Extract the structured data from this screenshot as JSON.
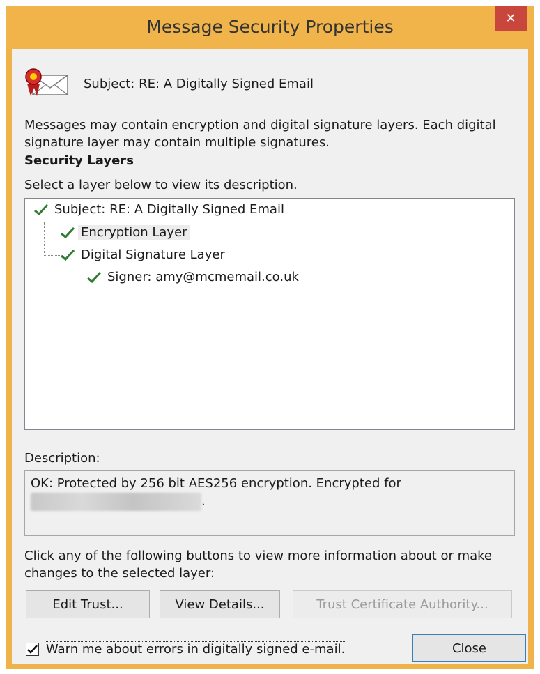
{
  "window": {
    "title": "Message Security Properties",
    "close_glyph": "✕"
  },
  "header": {
    "subject_line": "Subject:  RE: A Digitally Signed Email",
    "icon": "sealed-envelope-icon"
  },
  "intro_text": "Messages may contain encryption and digital signature layers. Each digital signature layer may contain multiple signatures.",
  "layers": {
    "heading": "Security Layers",
    "hint": "Select a layer below to view its description.",
    "items": [
      {
        "label": "Subject: RE: A Digitally Signed Email",
        "level": 0,
        "selected": false,
        "status": "ok"
      },
      {
        "label": "Encryption Layer",
        "level": 1,
        "selected": true,
        "status": "ok"
      },
      {
        "label": "Digital Signature Layer",
        "level": 1,
        "selected": false,
        "status": "ok"
      },
      {
        "label": "Signer: amy@mcmemail.co.uk",
        "level": 2,
        "selected": false,
        "status": "ok"
      }
    ]
  },
  "description": {
    "label": "Description:",
    "text": "OK: Protected by 256 bit AES256 encryption. Encrypted for",
    "redacted_suffix": "."
  },
  "buttons_hint": "Click any of the following buttons to view more information about or make changes to the selected layer:",
  "buttons": {
    "edit_trust": "Edit Trust...",
    "view_details": "View Details...",
    "trust_ca": "Trust Certificate Authority...",
    "close": "Close"
  },
  "warn_checkbox": {
    "label": "Warn me about errors in digitally signed e-mail.",
    "checked": true
  },
  "colors": {
    "title_bar": "#f0b44b",
    "close_button": "#c9463c",
    "check_green": "#2e7d32",
    "dialog_bg": "#f0f0f0"
  }
}
